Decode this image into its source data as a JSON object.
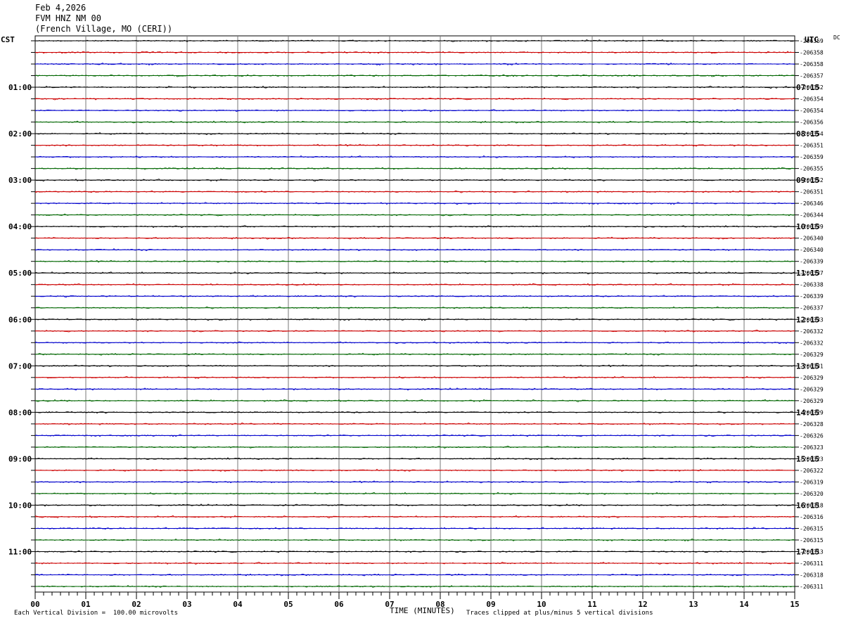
{
  "header": {
    "date": "Feb 4,2026",
    "station": "FVM HNZ NM 00",
    "location": "(French Village, MO (CERI))"
  },
  "chart_data": {
    "type": "line",
    "plot": "helicorder",
    "x_axis": {
      "label": "TIME (MINUTES)",
      "range": [
        0,
        15
      ],
      "ticks": [
        "00",
        "01",
        "02",
        "03",
        "04",
        "05",
        "06",
        "07",
        "08",
        "09",
        "10",
        "11",
        "12",
        "13",
        "14",
        "15"
      ]
    },
    "left_axis": {
      "title": "CST",
      "labels": [
        "01:00",
        "02:00",
        "03:00",
        "04:00",
        "05:00",
        "06:00",
        "07:00",
        "08:00",
        "09:00",
        "10:00",
        "11:00"
      ]
    },
    "right_axis": {
      "title": "UTC",
      "labels": [
        "07:15",
        "08:15",
        "09:15",
        "10:15",
        "11:15",
        "12:15",
        "13:15",
        "14:15",
        "15:15",
        "16:15",
        "17:15"
      ]
    },
    "dc_label": "DC",
    "dc_offsets": [
      "-206359",
      "-206358",
      "-206358",
      "-206357",
      "-206352",
      "-206354",
      "-206354",
      "-206356",
      "-206354",
      "-206351",
      "-206359",
      "-206355",
      "-206352",
      "-206351",
      "-206346",
      "-206344",
      "-206339",
      "-206340",
      "-206340",
      "-206339",
      "-206337",
      "-206338",
      "-206339",
      "-206337",
      "-206333",
      "-206332",
      "-206332",
      "-206329",
      "-206331",
      "-206329",
      "-206329",
      "-206329",
      "-206329",
      "-206328",
      "-206326",
      "-206323",
      "-206323",
      "-206322",
      "-206319",
      "-206320",
      "-206318",
      "-206316",
      "-206315",
      "-206315",
      "-206313",
      "-206311",
      "-206318",
      "-206311"
    ],
    "trace_colors": [
      "#000000",
      "#cc0000",
      "#0000cc",
      "#006600"
    ],
    "trace_count": 48,
    "grid": true
  },
  "footer": {
    "scale": "Each Vertical Division =  100.00 microvolts",
    "clip": "Traces clipped at plus/minus 5 vertical divisions"
  }
}
